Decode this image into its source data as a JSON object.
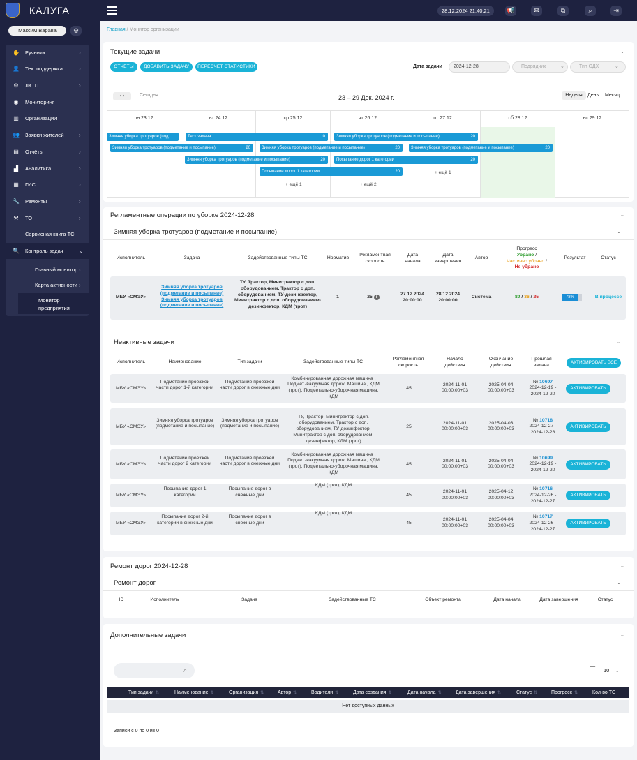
{
  "app": {
    "name": "КАЛУГА",
    "datetime": "28.12.2024 21:40:21"
  },
  "user": {
    "name": "Максим Варава"
  },
  "menu": [
    {
      "label": "Ручники",
      "icon": "hand-icon",
      "glyph": "✋",
      "chevron": true
    },
    {
      "label": "Тех. поддержка",
      "icon": "user-icon",
      "glyph": "👤",
      "chevron": true
    },
    {
      "label": "ЛКТП",
      "icon": "gear-icon",
      "glyph": "⚙",
      "chevron": true
    },
    {
      "label": "Мониторинг",
      "icon": "eye-icon",
      "glyph": "◉",
      "chevron": false
    },
    {
      "label": "Организации",
      "icon": "building-icon",
      "glyph": "▥",
      "chevron": false
    },
    {
      "label": "Заявки жителей",
      "icon": "users-icon",
      "glyph": "👥",
      "chevron": true
    },
    {
      "label": "Отчёты",
      "icon": "report-icon",
      "glyph": "▤",
      "chevron": true
    },
    {
      "label": "Аналитика",
      "icon": "chart-icon",
      "glyph": "▟",
      "chevron": true
    },
    {
      "label": "ГИС",
      "icon": "map-icon",
      "glyph": "▦",
      "chevron": true
    },
    {
      "label": "Ремонты",
      "icon": "wrench-icon",
      "glyph": "🔧",
      "chevron": true
    },
    {
      "label": "ТО",
      "icon": "tools-icon",
      "glyph": "⚒",
      "chevron": true
    },
    {
      "label": "Сервисная книга ТС",
      "icon": "book-icon",
      "glyph": "",
      "chevron": false
    },
    {
      "label": "Контроль задач",
      "icon": "search-icon",
      "glyph": "🔍",
      "chevron": true
    }
  ],
  "submenu": [
    {
      "label": "Главный монитор",
      "chevron": true
    },
    {
      "label": "Карта активности",
      "chevron": true
    }
  ],
  "active_sub": {
    "line1": "Монитор",
    "line2": "предприятия"
  },
  "breadcrumb": {
    "home": "Главная",
    "sep": "/",
    "current": "Монитор организации"
  },
  "current_tasks": {
    "title": "Текущие задачи",
    "buttons": [
      "ОТЧЁТЫ",
      "ДОБАВИТЬ ЗАДАЧУ",
      "ПЕРЕСЧЕТ СТАТИСТИКИ"
    ],
    "date_label": "Дата задачи",
    "date_value": "2024-12-28",
    "contractor_ph": "Подрядчик",
    "odh_ph": "Тип ОДХ"
  },
  "calendar": {
    "today": "Сегодня",
    "range": "23 – 29 Дек. 2024 г.",
    "views": [
      "Неделя",
      "День",
      "Месяц"
    ],
    "days": [
      "пн 23.12",
      "вт 24.12",
      "ср 25.12",
      "чт 26.12",
      "пт 27.12",
      "сб 28.12",
      "вс 29.12"
    ],
    "events": [
      {
        "text": "Зимняя уборка тротуаров (под...",
        "num": ""
      },
      {
        "text": "Тест задача",
        "num": "0"
      },
      {
        "text": "Зимняя уборка тротуаров (подметание и посыпание)",
        "num": "20"
      },
      {
        "text": "Зимняя уборка тротуаров (подметание и посыпание)",
        "num": "20"
      },
      {
        "text": "Зимняя уборка тротуаров (подметание и посыпание)",
        "num": "20"
      },
      {
        "text": "Зимняя уборка тротуаров (подметание и посыпание)",
        "num": "20"
      },
      {
        "text": "Зимняя уборка тротуаров (подметание и посыпание)",
        "num": "20"
      },
      {
        "text": "Посыпание дорог 1 категории",
        "num": "20"
      },
      {
        "text": "Посыпание дорог 1 категории",
        "num": "20"
      }
    ],
    "more": [
      "+ ещё 1",
      "+ ещё 2",
      "+ ещё 1"
    ]
  },
  "reglament": {
    "title": "Регламентные операции по уборке 2024-12-28",
    "subtitle": "Зимняя уборка тротуаров (подметание и посыпание)",
    "headers": {
      "executor": "Исполнитель",
      "task": "Задача",
      "types": "Задействованные типы ТС",
      "norm": "Норматив",
      "speed": "Регламентная скорость",
      "start": "Дата начала",
      "end": "Дата завершения",
      "author": "Автор",
      "progress": "Прогресс",
      "progress_done": "Убрано",
      "progress_part": "Частично убрано",
      "progress_not": "Не убрано",
      "result": "Результат",
      "status": "Статус"
    },
    "row": {
      "executor": "МБУ «СМЭУ»",
      "task": "Зимняя уборка тротуаров (подметание и посыпание)",
      "task2": "Зимняя уборка тротуаров (подметание и посыпание)",
      "types": "ТУ, Трактор, Минитрактор с доп. оборудованием, Трактор с доп. оборудованием, ТУ-дезинфектор, Минитрактор с доп. оборудованием-дезинфектор, КДМ (трот)",
      "norm": "1",
      "speed": "25",
      "start": "27.12.2024 20:00:00",
      "end": "28.12.2024 20:00:00",
      "author": "Система",
      "p_done": "89",
      "p_part": "36",
      "p_not": "25",
      "result": "78%",
      "result_pct": 78,
      "status": "В процессе"
    }
  },
  "inactive": {
    "title": "Неактивные задачи",
    "headers": {
      "executor": "Исполнитель",
      "name": "Наименование",
      "type": "Тип задачи",
      "types": "Задействованные типы ТС",
      "speed": "Регламентная скорость",
      "start": "Начало действия",
      "end": "Окончание действия",
      "prev": "Прошлая задача"
    },
    "activate_all": "АКТИВИРОВАТЬ ВСЕ",
    "activate": "АКТИВИРОВАТЬ",
    "rows": [
      {
        "executor": "МБУ «СМЭУ»",
        "name": "Подметание проезжей части дорог 1-й категории",
        "type": "Подметание проезжей части дорог в снежные дни",
        "types": "Комбинированная дорожная машина , Подмет.-вакуумная дорож. Машина , КДМ (трот), Подметально-уборочная машина, КДМ",
        "speed": "45",
        "start": "2024-11-01 00:00:00+03",
        "end": "2025-04-04 00:00:00+03",
        "prev_no": "№",
        "prev_id": "10697",
        "prev_dates": "2024-12-19 - 2024-12-20"
      },
      {
        "executor": "МБУ «СМЭУ»",
        "name": "Зимняя уборка тротуаров (подметание и посыпание)",
        "type": "Зимняя уборка тротуаров (подметание и посыпание)",
        "types": "ТУ, Трактор, Минитрактор с доп. оборудованием, Трактор с доп. оборудованием, ТУ-дезинфектор, Минитрактор с доп. оборудованием-дезинфектор, КДМ (трот)",
        "speed": "25",
        "start": "2024-11-01 00:00:00+03",
        "end": "2025-04-03 00:00:00+03",
        "prev_no": "№",
        "prev_id": "10718",
        "prev_dates": "2024-12-27 - 2024-12-28"
      },
      {
        "executor": "МБУ «СМЭУ»",
        "name": "Подметание проезжей части дорог 2 категории",
        "type": "Подметание проезжей части дорог в снежные дни",
        "types": "Комбинированная дорожная машина , Подмет.-вакуумная дорож. Машина , КДМ (трот), Подметально-уборочная машина, КДМ",
        "speed": "45",
        "start": "2024-11-01 00:00:00+03",
        "end": "2025-04-04 00:00:00+03",
        "prev_no": "№",
        "prev_id": "10699",
        "prev_dates": "2024-12-19 - 2024-12-20"
      },
      {
        "executor": "МБУ «СМЭУ»",
        "name": "Посыпание дорог 1 категории",
        "type": "Посыпание дорог в снежные дни",
        "types": "КДМ (трот), КДМ",
        "speed": "45",
        "start": "2024-11-01 00:00:00+03",
        "end": "2025-04-12 00:00:00+03",
        "prev_no": "№",
        "prev_id": "10716",
        "prev_dates": "2024-12-26 - 2024-12-27"
      },
      {
        "executor": "МБУ «СМЭУ»",
        "name": "Посыпание дорог 2-й категории в снежные дни",
        "type": "Посыпание дорог в снежные дни",
        "types": "КДМ (трот), КДМ",
        "speed": "45",
        "start": "2024-11-01 00:00:00+03",
        "end": "2025-04-04 00:00:00+03",
        "prev_no": "№",
        "prev_id": "10717",
        "prev_dates": "2024-12-26 - 2024-12-27"
      }
    ]
  },
  "repair": {
    "title": "Ремонт дорог 2024-12-28",
    "subtitle": "Ремонт дорог",
    "headers": [
      "ID",
      "Исполнитель",
      "Задача",
      "Задействованные ТС",
      "Объект ремонта",
      "Дата начала",
      "Дата завершения",
      "Статус"
    ]
  },
  "extra": {
    "title": "Дополнительные задачи",
    "page_size": "10",
    "headers": [
      "Тип задачи",
      "Наименование",
      "Организация",
      "Автор",
      "Водители",
      "Дата создания",
      "Дата начала",
      "Дата завершения",
      "Статус",
      "Прогресс",
      "Кол-во ТС"
    ],
    "empty": "Нет доступных данных",
    "records": "Записи с 0 по 0 из 0"
  }
}
